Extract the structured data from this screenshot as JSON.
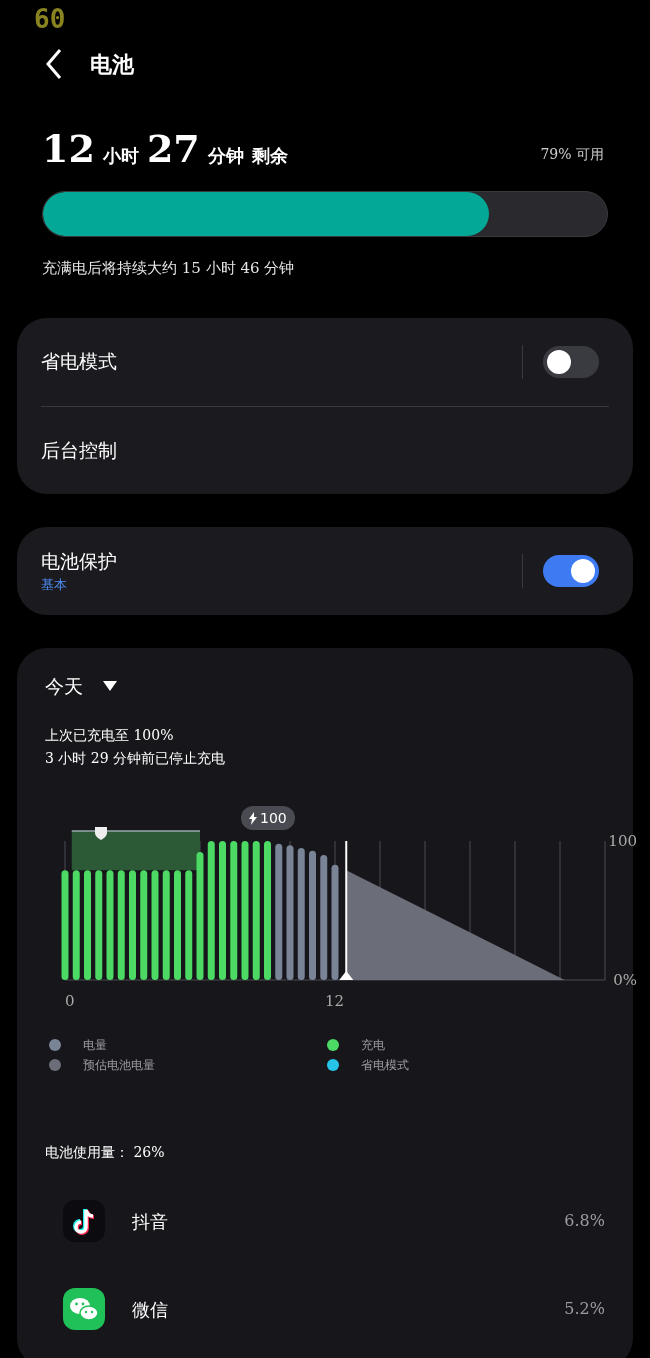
{
  "fps_counter": "60",
  "header": {
    "title": "电池"
  },
  "summary": {
    "hours": "12",
    "hours_unit": "小时",
    "minutes": "27",
    "minutes_unit": "分钟",
    "suffix": "剩余",
    "available": "79% 可用",
    "level": 0.79,
    "full_charge_note": "充满电后将持续大约 15 小时 46 分钟"
  },
  "settings_groups": [
    {
      "items": [
        {
          "label": "省电模式",
          "kind": "toggle",
          "on": false
        },
        {
          "label": "后台控制",
          "kind": "link"
        }
      ]
    },
    {
      "items": [
        {
          "label": "电池保护",
          "subtitle": "基本",
          "kind": "toggle",
          "on": true
        }
      ]
    }
  ],
  "usage": {
    "period": "今天",
    "last_charge": "上次已充电至 100%",
    "stopped": "3 小时 29 分钟前已停止充电",
    "charge_badge": "100",
    "chart_data": {
      "type": "bar",
      "x": [
        0,
        0.5,
        1,
        1.5,
        2,
        2.5,
        3,
        3.5,
        4,
        4.5,
        5,
        5.5,
        6,
        6.5,
        7,
        7.5,
        8,
        8.5,
        9,
        9.5,
        10,
        10.5,
        11,
        11.5,
        12
      ],
      "xlim": [
        0,
        24
      ],
      "ylim": [
        0,
        100
      ],
      "xticks": [
        {
          "value": 0,
          "label": "0"
        },
        {
          "value": 12,
          "label": "12"
        }
      ],
      "yticks": [
        {
          "value": 100,
          "label": "100"
        },
        {
          "value": 0,
          "label": "0%"
        }
      ],
      "ref_lines": [
        {
          "axis": "x",
          "value": 12.5
        }
      ],
      "series": [
        {
          "name": "充电",
          "color": "#4cd964",
          "values": [
            79,
            79,
            79,
            79,
            79,
            79,
            79,
            79,
            79,
            79,
            79,
            79,
            92,
            100,
            100,
            100,
            100,
            100,
            100,
            null,
            null,
            null,
            null,
            null,
            null
          ]
        },
        {
          "name": "电量",
          "color": "#7a8497",
          "values": [
            null,
            null,
            null,
            null,
            null,
            null,
            null,
            null,
            null,
            null,
            null,
            null,
            null,
            null,
            null,
            null,
            null,
            null,
            null,
            98,
            97,
            95,
            93,
            90,
            83
          ]
        }
      ]
    },
    "legend_extra": [
      {
        "label": "预估电池电量",
        "color": "#6b6e78"
      },
      {
        "label": "省电模式",
        "color": "#27c4ea"
      }
    ],
    "total": "电池使用量： 26%",
    "apps": [
      {
        "name": "抖音",
        "kind": "tiktok",
        "percent": "6.8%"
      },
      {
        "name": "微信",
        "kind": "wechat",
        "percent": "5.2%"
      }
    ]
  }
}
